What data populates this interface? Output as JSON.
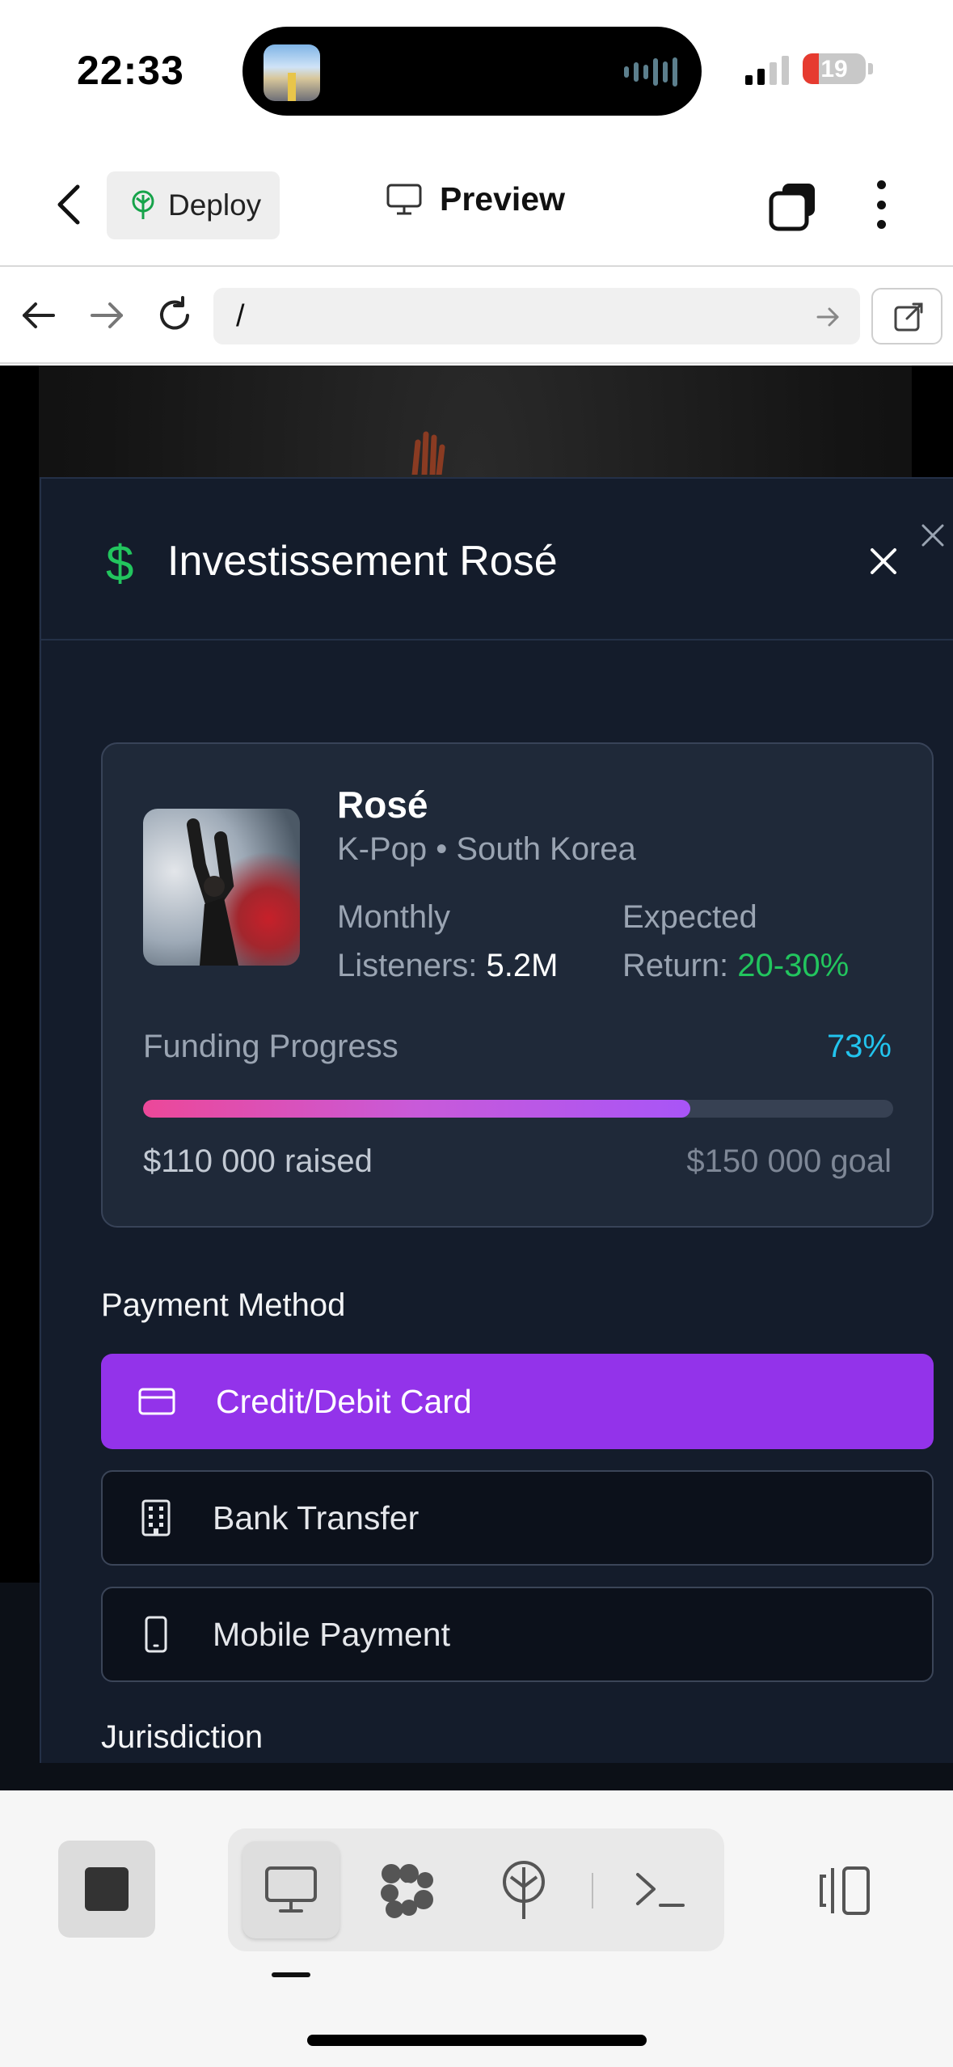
{
  "status": {
    "time": "22:33",
    "battery": "19",
    "battery_color": "#e63b30"
  },
  "appbar": {
    "deploy_label": "Deploy",
    "preview_label": "Preview",
    "icons": [
      "chevron-left-icon",
      "deploy-tree-icon",
      "monitor-icon",
      "stacked-squares-icon",
      "kebab-menu-icon"
    ]
  },
  "browser": {
    "url": "/",
    "icons": [
      "arrow-left-icon",
      "arrow-right-icon",
      "reload-icon",
      "go-arrow-icon",
      "open-external-icon"
    ]
  },
  "modal": {
    "title": "Investissement Rosé",
    "title_icon": "$",
    "accent": "#22c55e",
    "artist": {
      "name": "Rosé",
      "meta": "K-Pop • South Korea",
      "listeners_label_1": "Monthly",
      "listeners_label_2": "Listeners:",
      "listeners_value": "5.2M",
      "return_label_1": "Expected",
      "return_label_2": "Return:",
      "return_value": "20-30%"
    },
    "funding": {
      "label": "Funding Progress",
      "percent_text": "73%",
      "percent_value": 73,
      "raised": "$110 000 raised",
      "goal": "$150 000 goal"
    },
    "payment": {
      "section_label": "Payment Method",
      "options": [
        {
          "label": "Credit/Debit Card",
          "icon": "credit-card-icon",
          "selected": true
        },
        {
          "label": "Bank Transfer",
          "icon": "building-icon",
          "selected": false
        },
        {
          "label": "Mobile Payment",
          "icon": "smartphone-icon",
          "selected": false
        }
      ],
      "selected_color": "#9333ea"
    },
    "jurisdiction_label": "Jurisdiction"
  },
  "bottombar": {
    "tools": [
      "monitor-icon",
      "workflow-icon",
      "deploy-tree-icon",
      "terminal-icon"
    ],
    "active_tool": "monitor-icon"
  }
}
